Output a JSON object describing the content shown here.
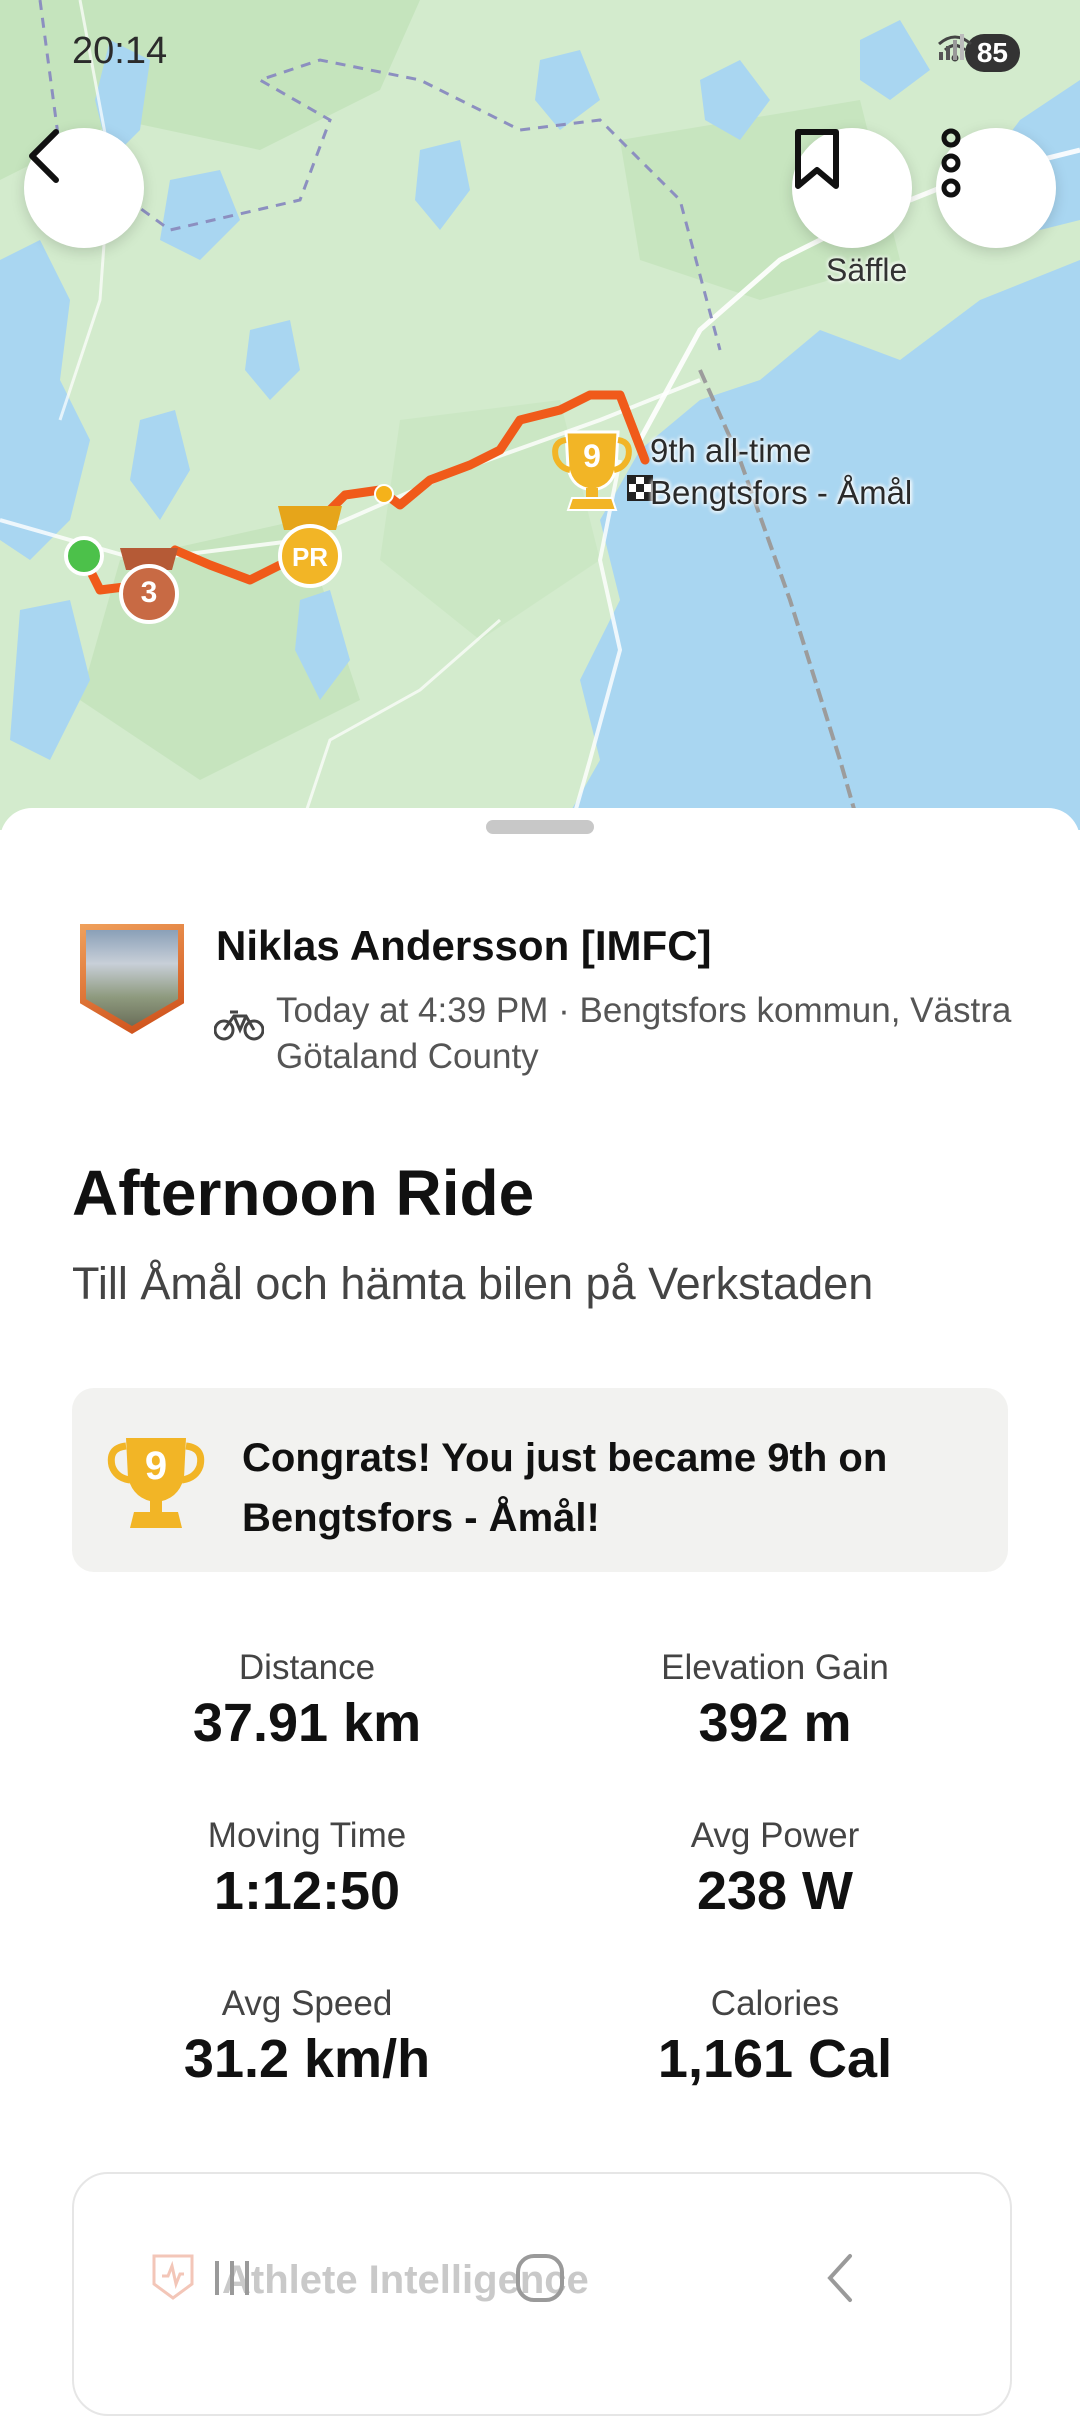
{
  "status_bar": {
    "time": "20:14",
    "battery": "85"
  },
  "map": {
    "place_label": "Säffle",
    "segment_rank": "9th all-time",
    "segment_name": "Bengtsfors - Åmål",
    "medal_bronze_rank": "3",
    "medal_pr_label": "PR",
    "trophy_rank": "9",
    "colors": {
      "route": "#f05a1a",
      "start": "#4cc14a",
      "water": "#a7d4f0",
      "land": "#d4ecd0"
    }
  },
  "athlete": {
    "name": "Niklas Andersson [IMFC]",
    "meta": "Today at 4:39 PM · Bengtsfors kommun, Västra Götaland County"
  },
  "activity": {
    "title": "Afternoon Ride",
    "description": "Till Åmål och hämta bilen på Verkstaden"
  },
  "congrats": {
    "trophy_rank": "9",
    "message": "Congrats! You just became 9th on Bengtsfors - Åmål!"
  },
  "stats": [
    {
      "label": "Distance",
      "value": "37.91 km"
    },
    {
      "label": "Elevation Gain",
      "value": "392 m"
    },
    {
      "label": "Moving Time",
      "value": "1:12:50"
    },
    {
      "label": "Avg Power",
      "value": "238 W"
    },
    {
      "label": "Avg Speed",
      "value": "31.2 km/h"
    },
    {
      "label": "Calories",
      "value": "1,161 Cal"
    }
  ],
  "athlete_intelligence": {
    "label": "Athlete Intelligence"
  },
  "icons": [
    "back-arrow-icon",
    "bookmark-icon",
    "more-vertical-icon",
    "bike-icon",
    "trophy-icon",
    "wifi-icon",
    "signal-icon",
    "recent-apps-icon",
    "home-icon",
    "nav-back-icon"
  ]
}
